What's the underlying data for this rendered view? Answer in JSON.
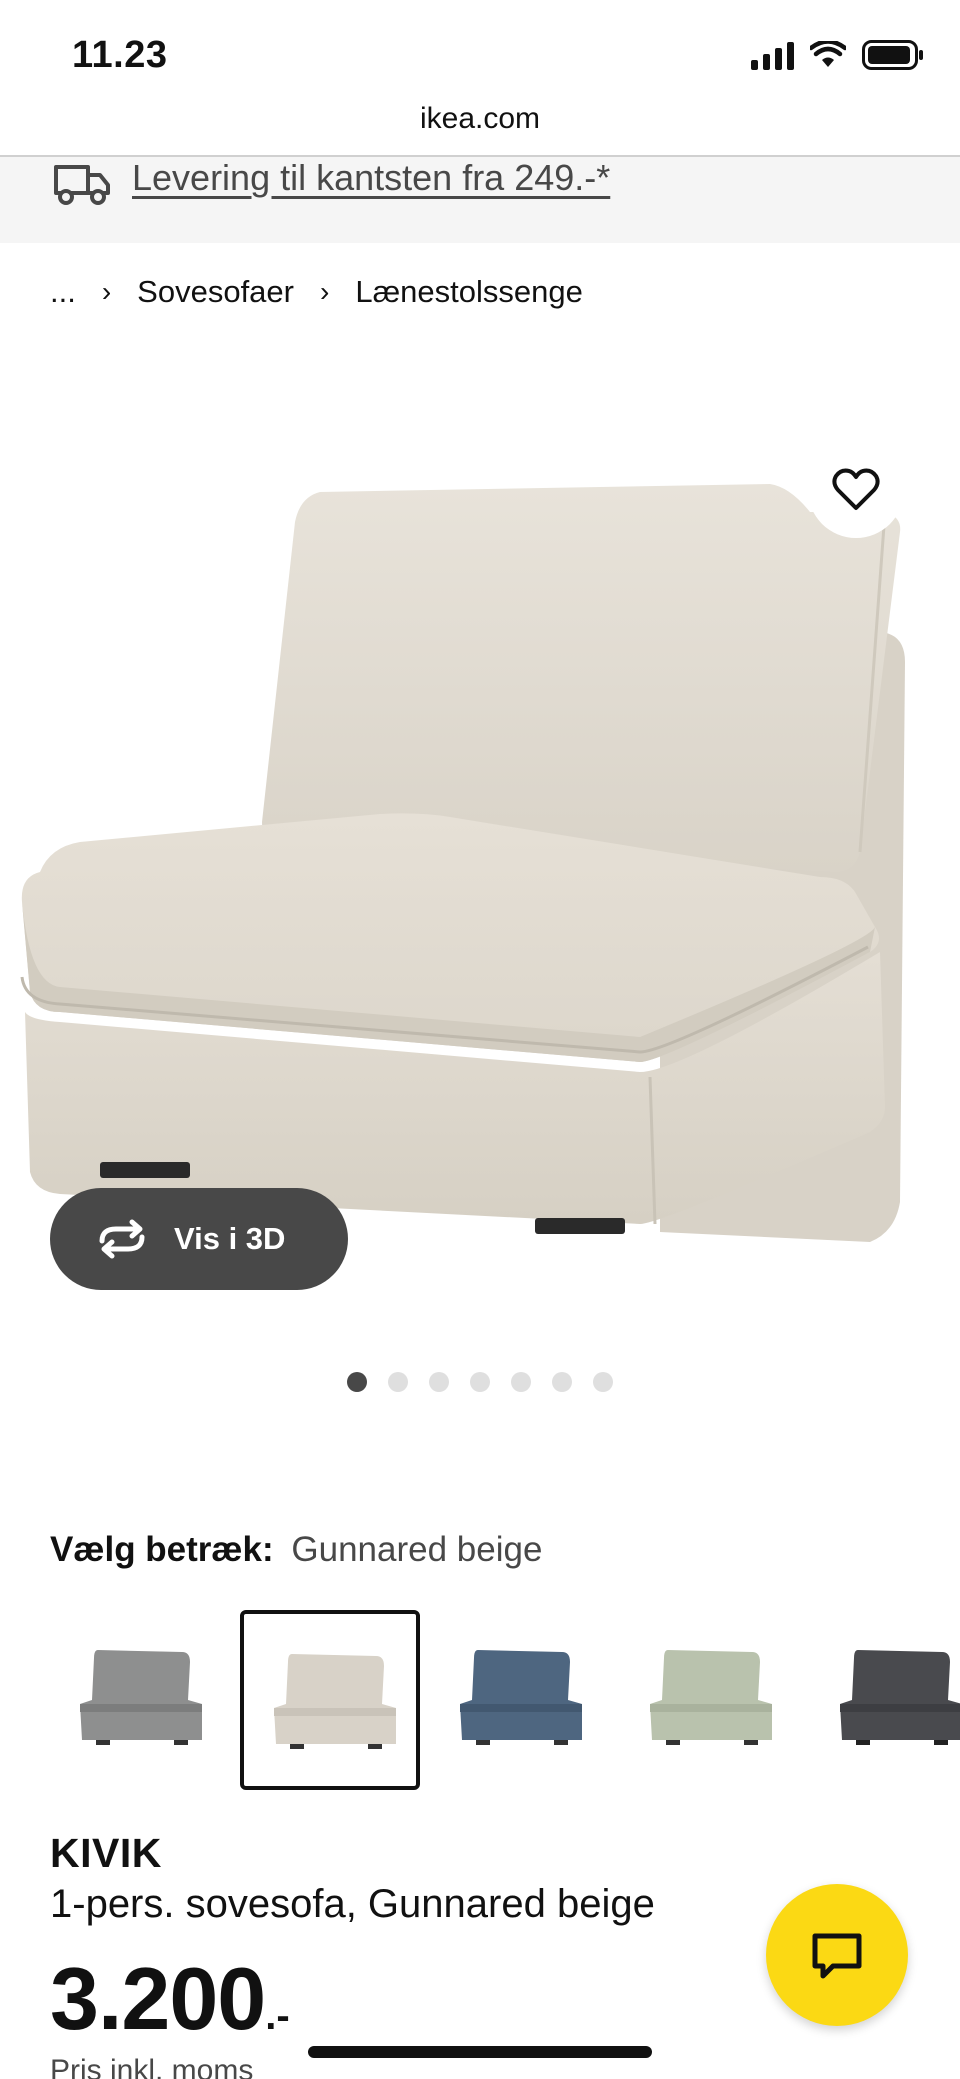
{
  "status_bar": {
    "time": "11.23"
  },
  "browser": {
    "url": "ikea.com"
  },
  "delivery_banner": {
    "text": "Levering til kantsten fra 249.-*"
  },
  "breadcrumb": [
    {
      "label": "..."
    },
    {
      "label": "Sovesofaer"
    },
    {
      "label": "Lænestolssenge"
    }
  ],
  "product_gallery": {
    "view_3d_label": "Vis i 3D",
    "image_count": 7,
    "active_index": 0
  },
  "cover_selector": {
    "label": "Vælg betræk:",
    "selected": "Gunnared beige",
    "options": [
      {
        "color": "#8e8f8f",
        "name": "grey"
      },
      {
        "color": "#d8d2c8",
        "name": "beige",
        "selected": true
      },
      {
        "color": "#4e6680",
        "name": "blue"
      },
      {
        "color": "#b9c2ad",
        "name": "light green"
      },
      {
        "color": "#494a4e",
        "name": "dark grey"
      }
    ]
  },
  "product": {
    "name": "KIVIK",
    "description": "1-pers. sovesofa, Gunnared beige",
    "price_integer": "3.200",
    "price_suffix": ".-",
    "price_note": "Pris inkl. moms"
  },
  "colors": {
    "accent_yellow": "#fbd914",
    "dark_button": "#484848",
    "banner_bg": "#f5f5f5",
    "sofa_fabric": "#e3ddd3"
  }
}
